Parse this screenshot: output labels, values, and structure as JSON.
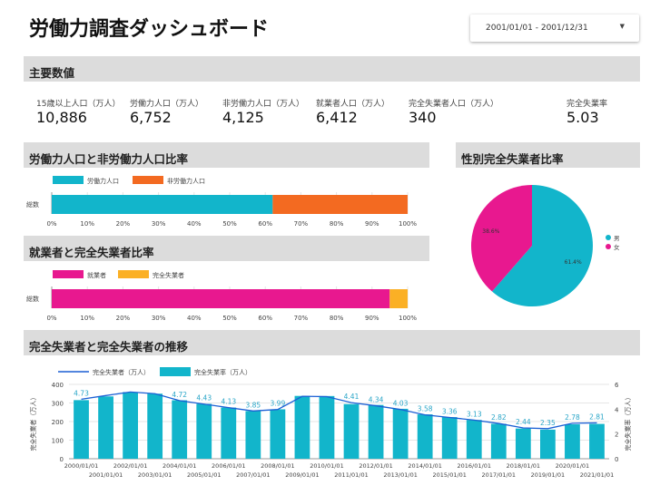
{
  "header": {
    "title": "労働力調査ダッシュボード",
    "date_range": "2001/01/01 - 2001/12/31",
    "caret_icon": "caret-down-icon"
  },
  "kpi": {
    "section_title": "主要数値",
    "items": [
      {
        "label": "15歳以上人口（万人）",
        "value": "10,886"
      },
      {
        "label": "労働力人口（万人）",
        "value": "6,752"
      },
      {
        "label": "非労働力人口（万人）",
        "value": "4,125"
      },
      {
        "label": "就業者人口（万人）",
        "value": "6,412"
      },
      {
        "label": "完全失業者人口（万人）",
        "value": "340"
      },
      {
        "label": "完全失業率",
        "value": "5.03"
      }
    ]
  },
  "chart_labor": {
    "title": "労働力人口と非労働力人口比率"
  },
  "chart_employed": {
    "title": "就業者と完全失業者比率"
  },
  "chart_gender": {
    "title": "性別完全失業者比率"
  },
  "chart_trend": {
    "title": "完全失業者と完全失業者の推移"
  },
  "chart_data": [
    {
      "type": "bar",
      "orientation": "horizontal",
      "stacked_percent": true,
      "categories": [
        "総数"
      ],
      "series": [
        {
          "name": "労働力人口",
          "values": [
            6752
          ],
          "color": "#12b5cb"
        },
        {
          "name": "非労働力人口",
          "values": [
            4125
          ],
          "color": "#f36a21"
        }
      ],
      "xticks": [
        "0%",
        "10%",
        "20%",
        "30%",
        "40%",
        "50%",
        "60%",
        "70%",
        "80%",
        "90%",
        "100%"
      ],
      "legend": "top-left"
    },
    {
      "type": "bar",
      "orientation": "horizontal",
      "stacked_percent": true,
      "categories": [
        "総数"
      ],
      "series": [
        {
          "name": "就業者",
          "values": [
            6412
          ],
          "color": "#e8188f"
        },
        {
          "name": "完全失業者",
          "values": [
            340
          ],
          "color": "#fbb025"
        }
      ],
      "xticks": [
        "0%",
        "10%",
        "20%",
        "30%",
        "40%",
        "50%",
        "60%",
        "70%",
        "80%",
        "90%",
        "100%"
      ],
      "legend": "top-left"
    },
    {
      "type": "pie",
      "labels": [
        "男",
        "女"
      ],
      "values": [
        61.4,
        38.6
      ],
      "value_labels": [
        "61.4%",
        "38.6%"
      ],
      "colors": [
        "#12b5cb",
        "#e8188f"
      ],
      "legend": "right"
    },
    {
      "type": "bar",
      "categories": [
        "2000/01/01",
        "2001/01/01",
        "2002/01/01",
        "2003/01/01",
        "2004/01/01",
        "2005/01/01",
        "2006/01/01",
        "2007/01/01",
        "2008/01/01",
        "2009/01/01",
        "2010/01/01",
        "2011/01/01",
        "2012/01/01",
        "2013/01/01",
        "2014/01/01",
        "2015/01/01",
        "2016/01/01",
        "2017/01/01",
        "2018/01/01",
        "2019/01/01",
        "2020/01/01",
        "2021/01/01"
      ],
      "series": [
        {
          "name": "完全失業者（万人）",
          "type": "line",
          "axis": "left",
          "color": "#1a5fd4",
          "values": [
            320,
            340,
            359,
            350,
            313,
            294,
            275,
            257,
            265,
            336,
            334,
            302,
            285,
            265,
            236,
            222,
            208,
            190,
            166,
            162,
            191,
            193
          ]
        },
        {
          "name": "完全失業率（万人）",
          "type": "bar",
          "axis": "right",
          "color": "#12b5cb",
          "values": [
            4.73,
            5.03,
            5.38,
            5.25,
            4.72,
            4.43,
            4.13,
            3.85,
            3.99,
            5.07,
            5.06,
            4.41,
            4.34,
            4.03,
            3.58,
            3.36,
            3.13,
            2.82,
            2.44,
            2.35,
            2.78,
            2.81
          ]
        }
      ],
      "value_labels": [
        "4.73",
        "",
        "",
        "",
        "4.72",
        "4.43",
        "4.13",
        "3.85",
        "3.99",
        "",
        "",
        "4.41",
        "4.34",
        "4.03",
        "3.58",
        "3.36",
        "3.13",
        "2.82",
        "2.44",
        "2.35",
        "2.78",
        "2.81"
      ],
      "ylabel": "完全失業者（万人）",
      "ylabel_right": "完全失業率（万人）",
      "ylim": [
        0,
        400
      ],
      "yticks_left": [
        "0",
        "100",
        "200",
        "300",
        "400"
      ],
      "ylim_right": [
        0,
        6
      ],
      "yticks_right": [
        "0",
        "2",
        "4",
        "6"
      ],
      "grid": true,
      "legend": "top-left"
    }
  ]
}
